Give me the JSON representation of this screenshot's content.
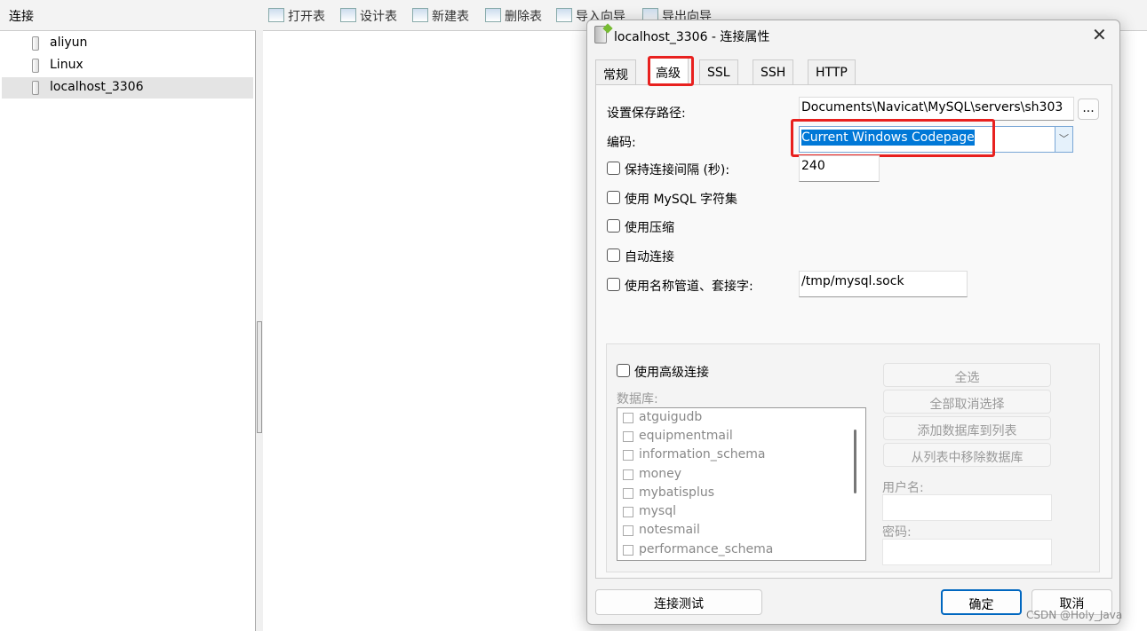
{
  "left_panel": {
    "title": "连接",
    "connections": [
      {
        "name": "aliyun"
      },
      {
        "name": "Linux"
      },
      {
        "name": "localhost_3306",
        "selected": true
      }
    ]
  },
  "toolbar": {
    "items": [
      {
        "label": "打开表",
        "icon": "open-table-icon"
      },
      {
        "label": "设计表",
        "icon": "design-table-icon"
      },
      {
        "label": "新建表",
        "icon": "new-table-icon"
      },
      {
        "label": "删除表",
        "icon": "delete-table-icon"
      },
      {
        "label": "导入向导",
        "icon": "import-wizard-icon"
      },
      {
        "label": "导出向导",
        "icon": "export-wizard-icon"
      }
    ]
  },
  "dialog": {
    "title": "localhost_3306 - 连接属性",
    "tabs": [
      {
        "label": "常规"
      },
      {
        "label": "高级",
        "active": true
      },
      {
        "label": "SSL"
      },
      {
        "label": "SSH"
      },
      {
        "label": "HTTP"
      }
    ],
    "save_path_label": "设置保存路径:",
    "save_path_value": "Documents\\Navicat\\MySQL\\servers\\sh303",
    "browse_label": "...",
    "encoding_label": "编码:",
    "encoding_value": "Current Windows Codepage",
    "keepalive_label": "保持连接间隔 (秒):",
    "keepalive_value": "240",
    "use_mysql_charset_label": "使用 MySQL 字符集",
    "use_compression_label": "使用压缩",
    "auto_connect_label": "自动连接",
    "named_pipe_label": "使用名称管道、套接字:",
    "named_pipe_value": "/tmp/mysql.sock",
    "advanced": {
      "use_advanced_label": "使用高级连接",
      "databases_label": "数据库:",
      "databases": [
        "atguigudb",
        "equipmentmail",
        "information_schema",
        "money",
        "mybatisplus",
        "mysql",
        "notesmail",
        "performance_schema"
      ],
      "select_all": "全选",
      "deselect_all": "全部取消选择",
      "add_db": "添加数据库到列表",
      "remove_db": "从列表中移除数据库",
      "username_label": "用户名:",
      "password_label": "密码:"
    },
    "test_button": "连接测试",
    "ok_button": "确定",
    "cancel_button": "取消",
    "highlight_color": "#e8211f",
    "selection_color": "#0078d7"
  },
  "watermark": "CSDN @Holy_Java"
}
